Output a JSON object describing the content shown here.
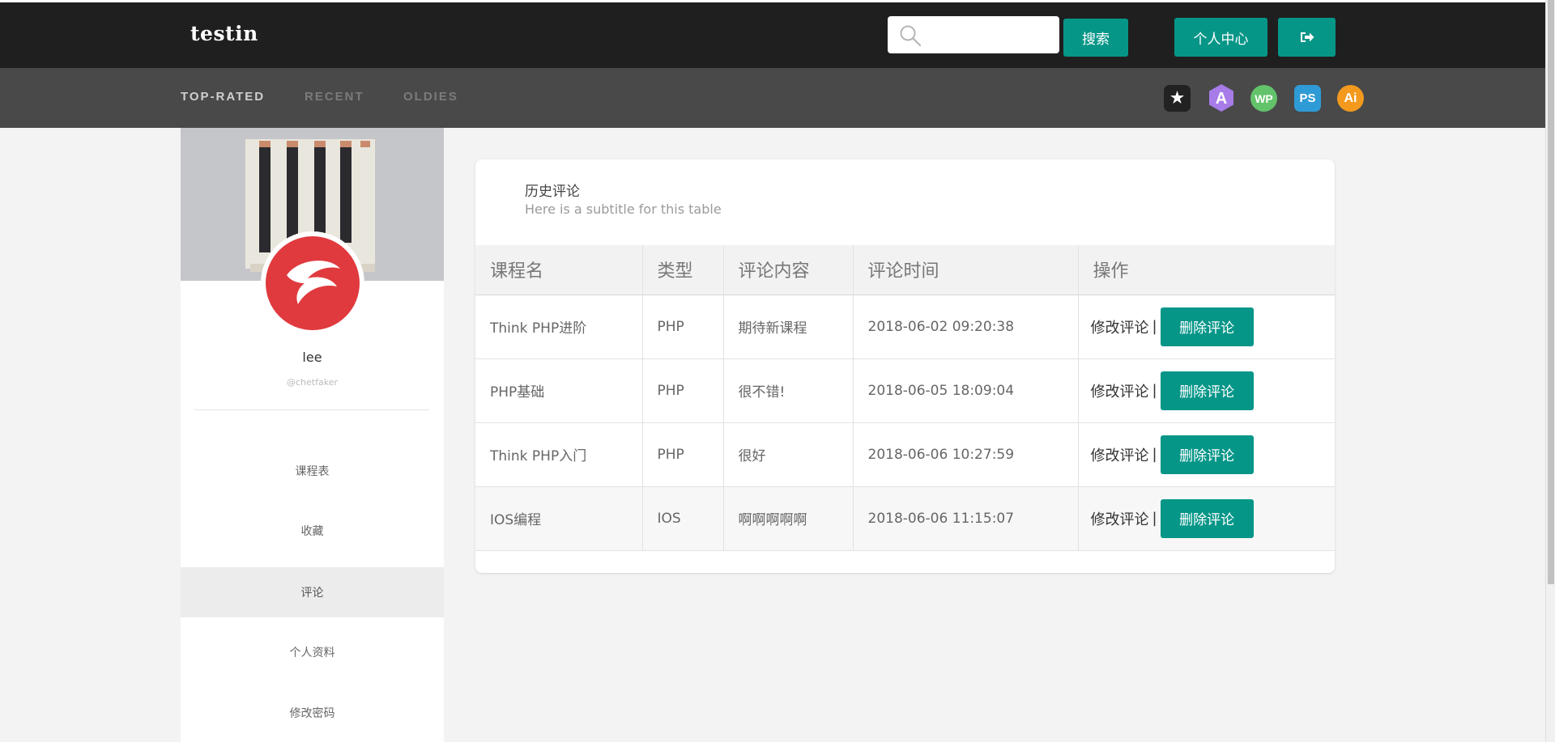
{
  "header": {
    "logo": "testin",
    "search": {
      "placeholder": "",
      "value": "",
      "button_label": "搜索"
    },
    "personal_center_label": "个人中心",
    "logout_icon": "sign-out-icon"
  },
  "subnav": {
    "tabs": [
      {
        "label": "TOP-RATED",
        "active": true
      },
      {
        "label": "RECENT",
        "active": false
      },
      {
        "label": "OLDIES",
        "active": false
      }
    ],
    "icons": [
      {
        "name": "star-icon",
        "text": "★",
        "color": "#222222"
      },
      {
        "name": "a-icon",
        "text": "A",
        "color": "#a77be8"
      },
      {
        "name": "wp-icon",
        "text": "WP",
        "color": "#63c36b"
      },
      {
        "name": "ps-icon",
        "text": "PS",
        "color": "#2f9bd6"
      },
      {
        "name": "ai-icon",
        "text": "Ai",
        "color": "#f39a1e"
      }
    ]
  },
  "sidebar": {
    "name": "lee",
    "handle": "@chetfaker",
    "items": [
      {
        "label": "课程表",
        "active": false
      },
      {
        "label": "收藏",
        "active": false
      },
      {
        "label": "评论",
        "active": true
      },
      {
        "label": "个人资料",
        "active": false
      },
      {
        "label": "修改密码",
        "active": false
      }
    ]
  },
  "card": {
    "title": "历史评论",
    "subtitle": "Here is a subtitle for this table",
    "columns": [
      "课程名",
      "类型",
      "评论内容",
      "评论时间",
      "操作"
    ],
    "rows": [
      {
        "course": "Think PHP进阶",
        "type": "PHP",
        "comment": "期待新课程",
        "time": "2018-06-02 09:20:38",
        "edit": "修改评论",
        "sep": "|",
        "delete": "删除评论"
      },
      {
        "course": "PHP基础",
        "type": "PHP",
        "comment": "很不错!",
        "time": "2018-06-05 18:09:04",
        "edit": "修改评论",
        "sep": "|",
        "delete": "删除评论"
      },
      {
        "course": "Think PHP入门",
        "type": "PHP",
        "comment": "很好",
        "time": "2018-06-06 10:27:59",
        "edit": "修改评论",
        "sep": "|",
        "delete": "删除评论"
      },
      {
        "course": "IOS编程",
        "type": "IOS",
        "comment": "啊啊啊啊啊",
        "time": "2018-06-06 11:15:07",
        "edit": "修改评论",
        "sep": "|",
        "delete": "删除评论"
      }
    ]
  },
  "colors": {
    "accent": "#069688",
    "topbar": "#1f1f1f",
    "subnav": "#494949"
  }
}
